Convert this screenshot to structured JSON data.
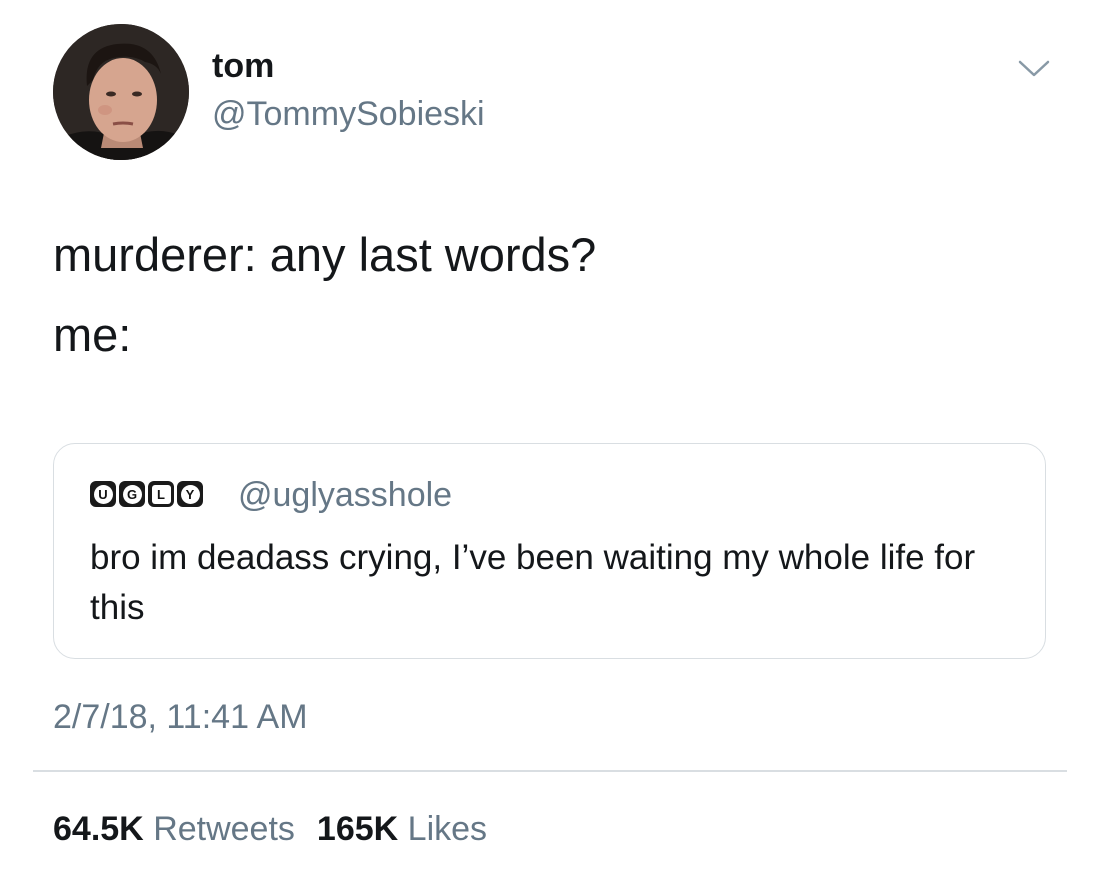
{
  "tweet": {
    "author": {
      "display_name": "tom",
      "handle": "@TommySobieski"
    },
    "text_lines": [
      "murderer: any last words?",
      "me:"
    ],
    "quoted_tweet": {
      "logo_letters": [
        "U",
        "G",
        "L",
        "Y"
      ],
      "handle": "@uglyasshole",
      "text": "bro im deadass crying, I’ve been waiting my whole life for this"
    },
    "timestamp": "2/7/18, 11:41 AM",
    "stats": {
      "retweets_count": "64.5K",
      "retweets_label": "Retweets",
      "likes_count": "165K",
      "likes_label": "Likes"
    }
  },
  "colors": {
    "primary_text": "#14171a",
    "secondary_text": "#657786",
    "border": "#d9dee2"
  },
  "icons": {
    "menu": "chevron-down-icon"
  }
}
